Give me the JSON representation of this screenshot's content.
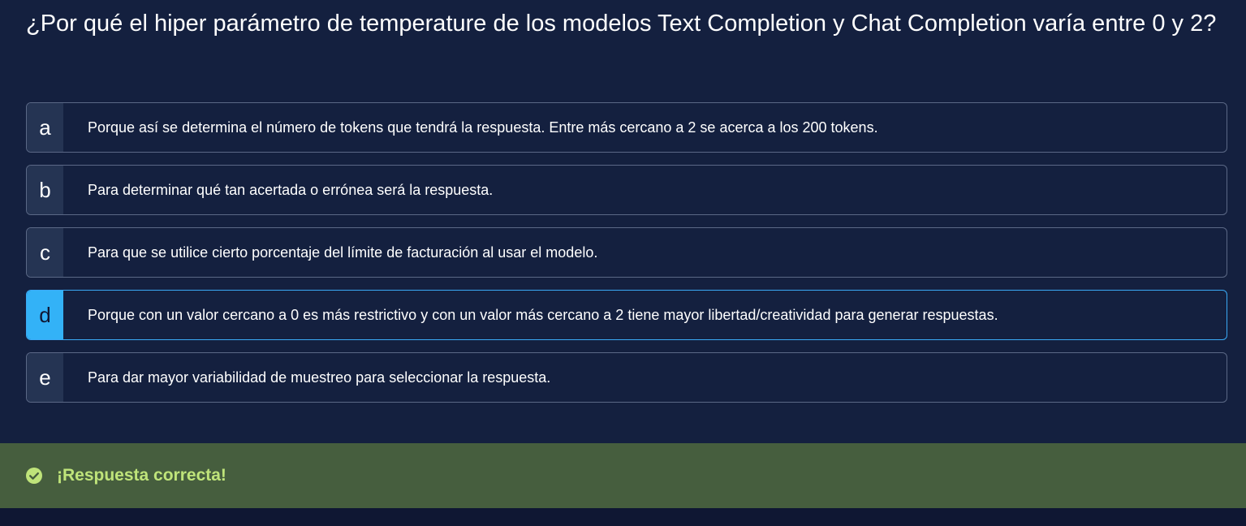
{
  "question": {
    "text": "¿Por qué el hiper parámetro de temperature de los modelos Text Completion y Chat Completion varía entre 0 y 2?"
  },
  "options": [
    {
      "letter": "a",
      "text": "Porque así se determina el número de tokens que tendrá la respuesta. Entre más cercano a 2 se acerca a los 200 tokens."
    },
    {
      "letter": "b",
      "text": "Para determinar qué tan acertada o errónea será la respuesta."
    },
    {
      "letter": "c",
      "text": "Para que se utilice cierto porcentaje del límite de facturación al usar el modelo."
    },
    {
      "letter": "d",
      "text": "Porque con un valor cercano a 0 es más restrictivo y con un valor más cercano a 2 tiene mayor libertad/creatividad para generar respuestas."
    },
    {
      "letter": "e",
      "text": "Para dar mayor variabilidad de muestreo para seleccionar la respuesta."
    }
  ],
  "selected_option": "d",
  "feedback": {
    "message": "¡Respuesta correcta!",
    "icon": "check-circle-icon"
  },
  "colors": {
    "background": "#14203f",
    "selected_accent": "#33b2f7",
    "feedback_bg": "#465e3e",
    "feedback_text": "#bfe47a"
  }
}
